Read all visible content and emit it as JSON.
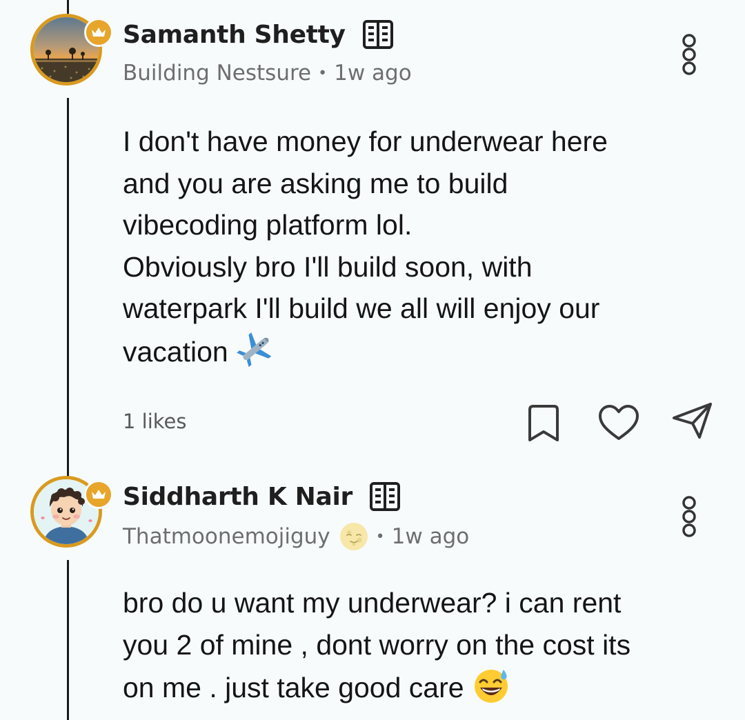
{
  "comments": [
    {
      "author": "Samanth Shetty",
      "headline": "Building Nestsure",
      "separator": "•",
      "time": "1w ago",
      "body": "I don't have money for underwear here\nand you are asking me to build\nvibecoding platform lol.\nObviously bro I'll build soon, with\nwaterpark I'll build we all will enjoy our\nvacation",
      "body_emoji": "airplane",
      "likes": "1 likes"
    },
    {
      "author": "Siddharth K Nair",
      "headline": "Thatmoonemojiguy",
      "headline_emoji": "moon-face",
      "separator": "•",
      "time": "1w ago",
      "body": "bro do u want my underwear? i can rent\nyou 2 of mine , dont worry on the cost its\non me . just take good care",
      "body_emoji": "grinning-sweat"
    }
  ],
  "colors": {
    "background": "#f7fbfc",
    "avatar_ring": "#d99a1e",
    "crown_badge": "#e7a52a",
    "meta_text": "#6e6e6e",
    "thread_line": "#1a1a1a"
  },
  "icons": [
    "crown-icon",
    "building-icon",
    "more-options-icon",
    "bookmark-icon",
    "heart-icon",
    "share-icon",
    "airplane-emoji",
    "moon-face-emoji",
    "grinning-sweat-emoji"
  ]
}
